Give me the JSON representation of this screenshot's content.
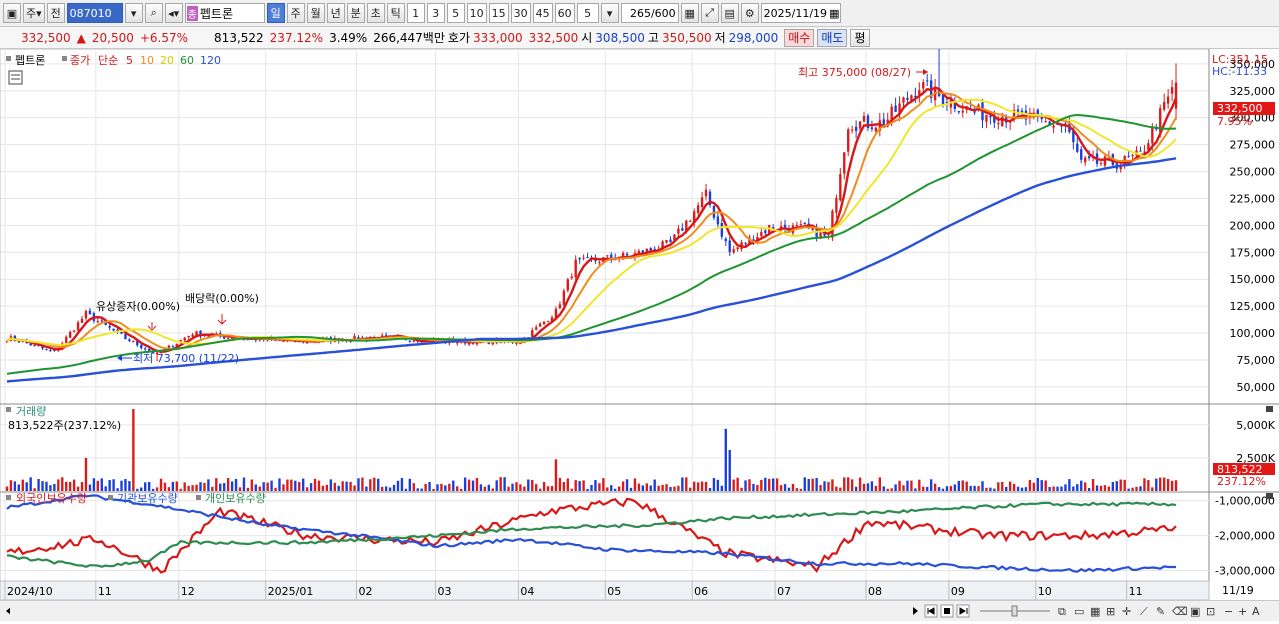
{
  "toolbar": {
    "mode_label": "주",
    "prev_label": "전",
    "stock_code": "087010",
    "stock_badge": "종",
    "stock_name": "펩트론",
    "periods": [
      "일",
      "주",
      "월",
      "년",
      "분",
      "초",
      "틱"
    ],
    "active_period": "일",
    "intervals": [
      "1",
      "3",
      "5",
      "10",
      "15",
      "30",
      "45",
      "60"
    ],
    "interval_value": "5",
    "count": "265",
    "count_total": "/600",
    "date": "2025/11/19"
  },
  "quote": {
    "price": "332,500",
    "change": "20,500",
    "change_pct": "+6.57%",
    "volume": "813,522",
    "volume_ratio": "237.12%",
    "turnover": "3.49%",
    "amount": "266,447백만",
    "ask_label": "호가",
    "ask1": "333,000",
    "ask2": "332,500",
    "open_label": "시",
    "open": "308,500",
    "high_label": "고",
    "high": "350,500",
    "low_label": "저",
    "low": "298,000",
    "buy_label": "매수",
    "sell_label": "매도",
    "avg_label": "평"
  },
  "colors": {
    "up": "#dd1a1a",
    "down": "#1a3fd8",
    "ma5": "#d81818",
    "ma10": "#f08c1e",
    "ma20": "#f0e62a",
    "ma60": "#1e9432",
    "ma120": "#2850d8",
    "foreign": "#d81818",
    "institution": "#2850d8",
    "individual": "#2e8c50"
  },
  "chart_data": [
    {
      "type": "candlestick",
      "legend": {
        "name": "펩트론",
        "close_label": "종가",
        "ma_type": "단순",
        "periods": [
          "5",
          "10",
          "20",
          "60",
          "120"
        ]
      },
      "y_ticks": [
        "350,000",
        "325,000",
        "300,000",
        "275,000",
        "250,000",
        "225,000",
        "200,000",
        "175,000",
        "150,000",
        "125,000",
        "100,000",
        "75,000",
        "50,000"
      ],
      "ylim": [
        35000,
        362000
      ],
      "right_info": [
        "LC:351.15",
        "HC:-11.33"
      ],
      "last_price_label": "332,500",
      "last_change_label": "7.95%",
      "x_labels": [
        "2024/10",
        "11",
        "12",
        "2025/01",
        "02",
        "03",
        "04",
        "05",
        "06",
        "07",
        "08",
        "09",
        "10",
        "11"
      ],
      "end_date_label": "11/19",
      "annotations": {
        "max": "최고 375,000 (08/27)",
        "min": "최저 73,700 (11/22)",
        "event1": "유상증자(0.00%)",
        "event2": "배당락(0.00%)"
      },
      "anchors": [
        {
          "date": "2024/10/02",
          "close": 95000
        },
        {
          "date": "2024/10/17",
          "close": 82000
        },
        {
          "date": "2024/10/29",
          "close": 118000
        },
        {
          "date": "2024/11/12",
          "close": 95000
        },
        {
          "date": "2024/11/22",
          "close": 80000
        },
        {
          "date": "2024/12/05",
          "close": 100000
        },
        {
          "date": "2024/12/18",
          "close": 96000
        },
        {
          "date": "2025/01/10",
          "close": 92000
        },
        {
          "date": "2025/02/10",
          "close": 96000
        },
        {
          "date": "2025/03/10",
          "close": 92000
        },
        {
          "date": "2025/04/01",
          "close": 92000
        },
        {
          "date": "2025/04/14",
          "close": 120000
        },
        {
          "date": "2025/04/21",
          "close": 165000
        },
        {
          "date": "2025/05/09",
          "close": 172000
        },
        {
          "date": "2025/05/23",
          "close": 183000
        },
        {
          "date": "2025/06/05",
          "close": 228000
        },
        {
          "date": "2025/06/13",
          "close": 175000
        },
        {
          "date": "2025/06/27",
          "close": 198000
        },
        {
          "date": "2025/07/10",
          "close": 197000
        },
        {
          "date": "2025/07/18",
          "close": 188000
        },
        {
          "date": "2025/07/25",
          "close": 295000
        },
        {
          "date": "2025/08/07",
          "close": 295000
        },
        {
          "date": "2025/08/20",
          "close": 330000
        },
        {
          "date": "2025/08/27",
          "close": 320000
        },
        {
          "date": "2025/09/09",
          "close": 305000
        },
        {
          "date": "2025/09/25",
          "close": 300000
        },
        {
          "date": "2025/10/10",
          "close": 292000
        },
        {
          "date": "2025/10/16",
          "close": 258000
        },
        {
          "date": "2025/10/30",
          "close": 258000
        },
        {
          "date": "2025/11/06",
          "close": 265000
        },
        {
          "date": "2025/11/14",
          "close": 310000
        },
        {
          "date": "2025/11/19",
          "close": 332500
        }
      ],
      "ma_end_values": {
        "ma5": 318000,
        "ma10": 300000,
        "ma20": 280000,
        "ma60": 290000,
        "ma120": 262000
      }
    },
    {
      "type": "bar",
      "title": "거래량",
      "current_label": "813,522주(237.12%)",
      "y_ticks": [
        "5,000K",
        "2,500K"
      ],
      "ylim": [
        0,
        6200
      ],
      "unit": "K",
      "last_volume_label": "813,522",
      "last_ratio_label": "237.12%",
      "spikes": [
        {
          "date": "2024/10/29",
          "value": 2500
        },
        {
          "date": "2024/11/14",
          "value": 6500
        },
        {
          "date": "2025/04/14",
          "value": 2400
        },
        {
          "date": "2025/06/12",
          "value": 4700
        },
        {
          "date": "2025/06/13",
          "value": 3100
        }
      ]
    },
    {
      "type": "line",
      "series_names": [
        "외국인보유수량",
        "기관보유수량",
        "개인보유수량"
      ],
      "y_ticks": [
        "-1,000,000",
        "-2,000,000",
        "-3,000,000"
      ],
      "ylim": [
        -3300000,
        -750000
      ],
      "series": [
        {
          "name": "외국인보유수량",
          "anchors": [
            {
              "date": "2024/10/01",
              "value": -2500000
            },
            {
              "date": "2024/11/01",
              "value": -2100000
            },
            {
              "date": "2024/11/25",
              "value": -3000000
            },
            {
              "date": "2024/12/15",
              "value": -1300000
            },
            {
              "date": "2025/01/15",
              "value": -2000000
            },
            {
              "date": "2025/03/01",
              "value": -2200000
            },
            {
              "date": "2025/04/10",
              "value": -1300000
            },
            {
              "date": "2025/05/10",
              "value": -1000000
            },
            {
              "date": "2025/06/12",
              "value": -2500000
            },
            {
              "date": "2025/07/15",
              "value": -2900000
            },
            {
              "date": "2025/08/01",
              "value": -1600000
            },
            {
              "date": "2025/09/15",
              "value": -2000000
            },
            {
              "date": "2025/10/20",
              "value": -2000000
            },
            {
              "date": "2025/11/19",
              "value": -1800000
            }
          ]
        },
        {
          "name": "기관보유수량",
          "anchors": [
            {
              "date": "2024/10/01",
              "value": -1200000
            },
            {
              "date": "2024/10/29",
              "value": -850000
            },
            {
              "date": "2024/11/20",
              "value": -1100000
            },
            {
              "date": "2025/01/01",
              "value": -1700000
            },
            {
              "date": "2025/02/01",
              "value": -2000000
            },
            {
              "date": "2025/03/01",
              "value": -2300000
            },
            {
              "date": "2025/04/01",
              "value": -2100000
            },
            {
              "date": "2025/05/01",
              "value": -2400000
            },
            {
              "date": "2025/06/10",
              "value": -2500000
            },
            {
              "date": "2025/07/15",
              "value": -2800000
            },
            {
              "date": "2025/08/15",
              "value": -2800000
            },
            {
              "date": "2025/09/10",
              "value": -2900000
            },
            {
              "date": "2025/10/15",
              "value": -3000000
            },
            {
              "date": "2025/11/19",
              "value": -2900000
            }
          ]
        },
        {
          "name": "개인보유수량",
          "anchors": [
            {
              "date": "2024/10/01",
              "value": -2600000
            },
            {
              "date": "2024/11/01",
              "value": -2900000
            },
            {
              "date": "2024/11/20",
              "value": -2700000
            },
            {
              "date": "2024/12/01",
              "value": -2200000
            },
            {
              "date": "2025/01/15",
              "value": -2200000
            },
            {
              "date": "2025/03/01",
              "value": -2000000
            },
            {
              "date": "2025/04/01",
              "value": -1800000
            },
            {
              "date": "2025/05/15",
              "value": -1700000
            },
            {
              "date": "2025/06/12",
              "value": -1500000
            },
            {
              "date": "2025/07/15",
              "value": -1400000
            },
            {
              "date": "2025/08/15",
              "value": -1300000
            },
            {
              "date": "2025/10/01",
              "value": -1100000
            },
            {
              "date": "2025/11/19",
              "value": -1100000
            }
          ]
        }
      ]
    }
  ]
}
